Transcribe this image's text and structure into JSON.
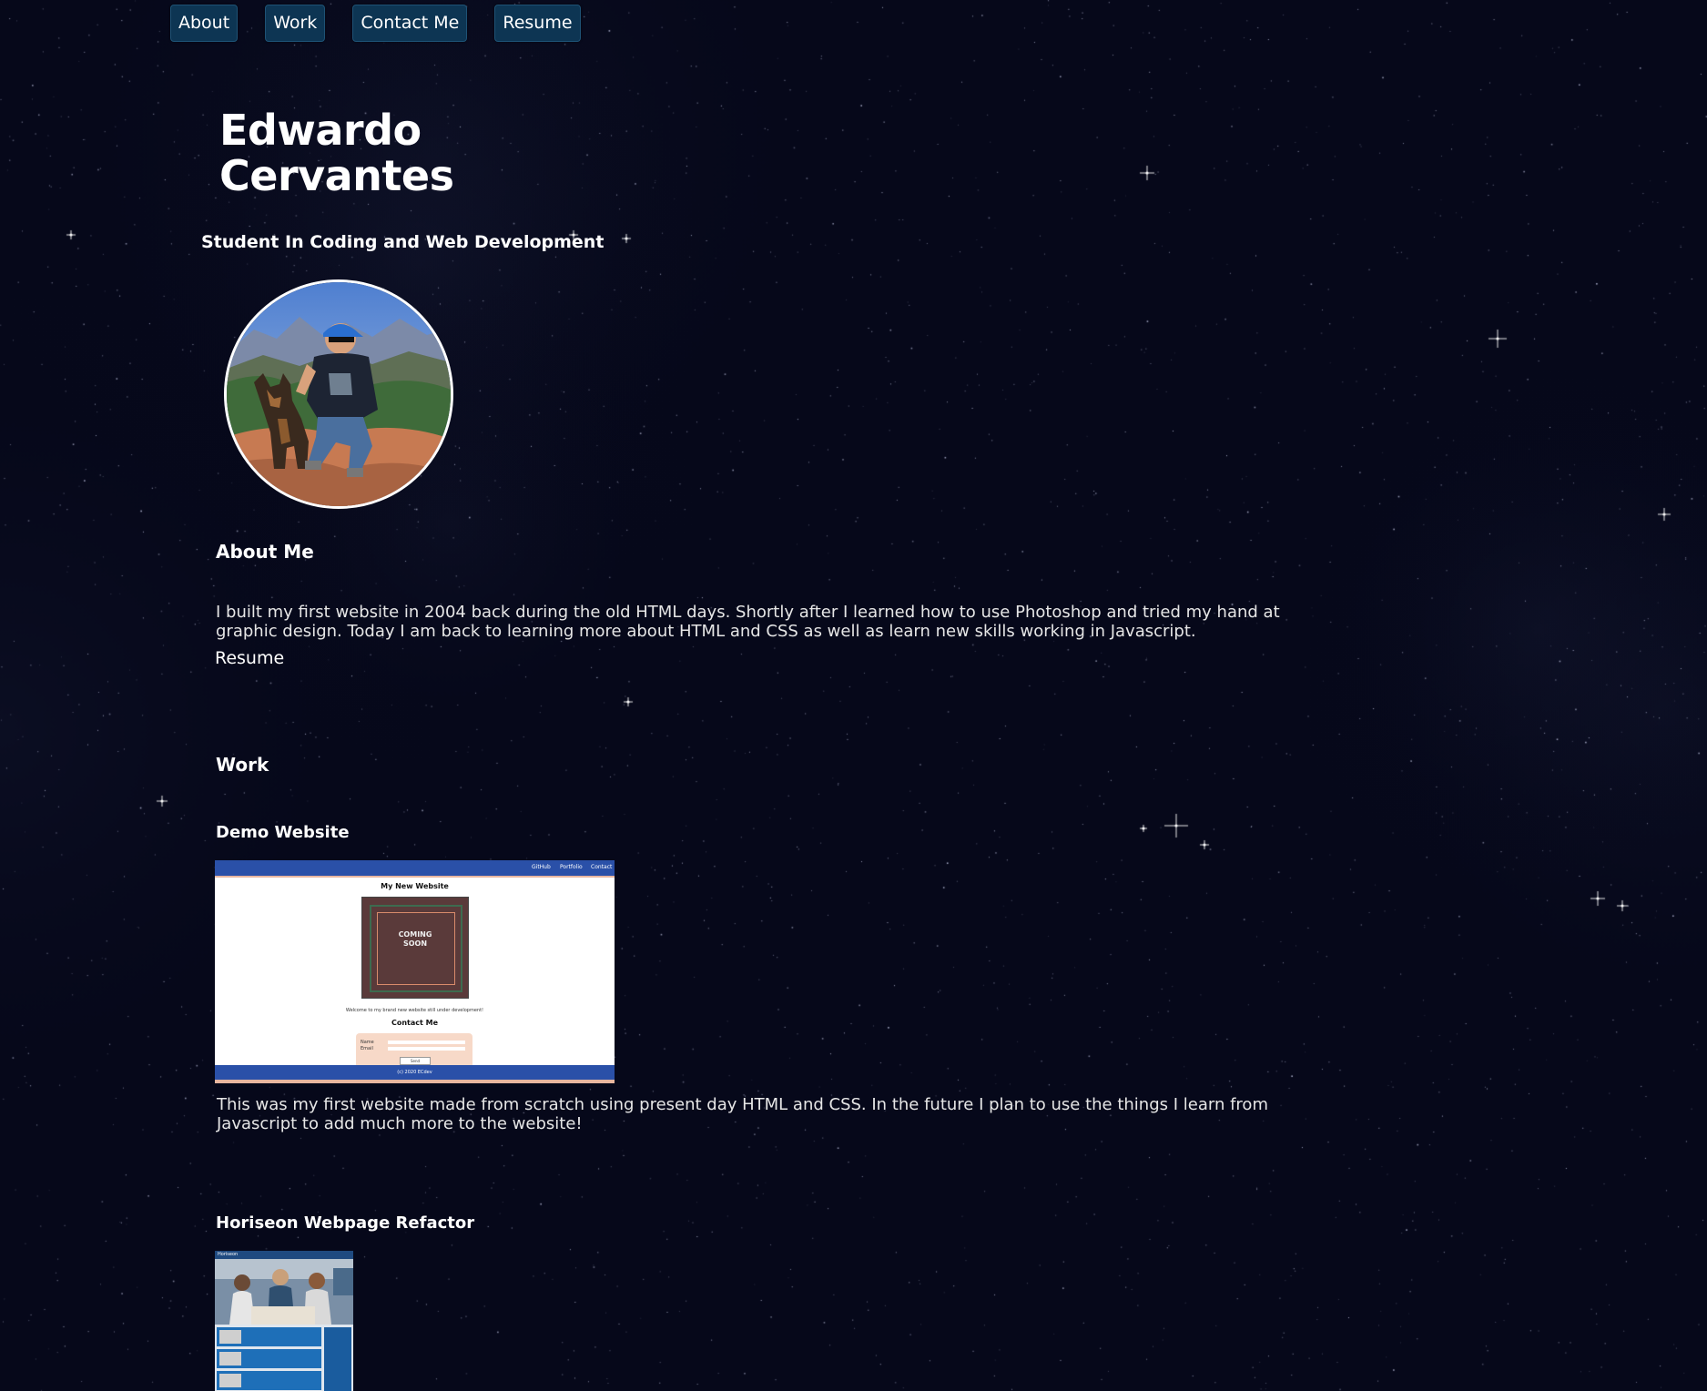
{
  "nav": {
    "items": [
      {
        "label": "About"
      },
      {
        "label": "Work"
      },
      {
        "label": "Contact Me"
      },
      {
        "label": "Resume"
      }
    ]
  },
  "header": {
    "name_line1": "Edwardo",
    "name_line2": "Cervantes",
    "subtitle": "Student In Coding and Web Development"
  },
  "about": {
    "heading": "About Me",
    "text": "I built my first website in 2004 back during the old HTML days. Shortly after I learned how to use Photoshop and tried my hand at graphic design. Today I am back to learning more about HTML and CSS as well as learn new skills working in Javascript.",
    "resume_link": "Resume"
  },
  "work": {
    "heading": "Work",
    "projects": [
      {
        "title": "Demo Website",
        "screenshot": {
          "nav": [
            "GitHub",
            "Portfolio",
            "Contact"
          ],
          "title": "My New Website",
          "badge_line1": "COMING",
          "badge_line2": "SOON",
          "welcome": "Welcome to my brand new website still under development!",
          "contact_heading": "Contact Me",
          "form_labels": [
            "Name",
            "Email"
          ],
          "send": "Send",
          "footer": "(c) 2020 ECdev"
        },
        "description": "This was my first website made from scratch using present day HTML and CSS. In the future I plan to use the things I learn from Javascript to add much more to the website!"
      },
      {
        "title": "Horiseon Webpage Refactor",
        "screenshot": {
          "logo": "Horiseon"
        }
      }
    ]
  },
  "colors": {
    "background": "#06081a",
    "nav_button": "#0d3553",
    "text": "#ffffff",
    "body_text": "#e6e6e6",
    "demo_blue": "#2a50a8",
    "demo_peach": "#e8b6a0"
  }
}
